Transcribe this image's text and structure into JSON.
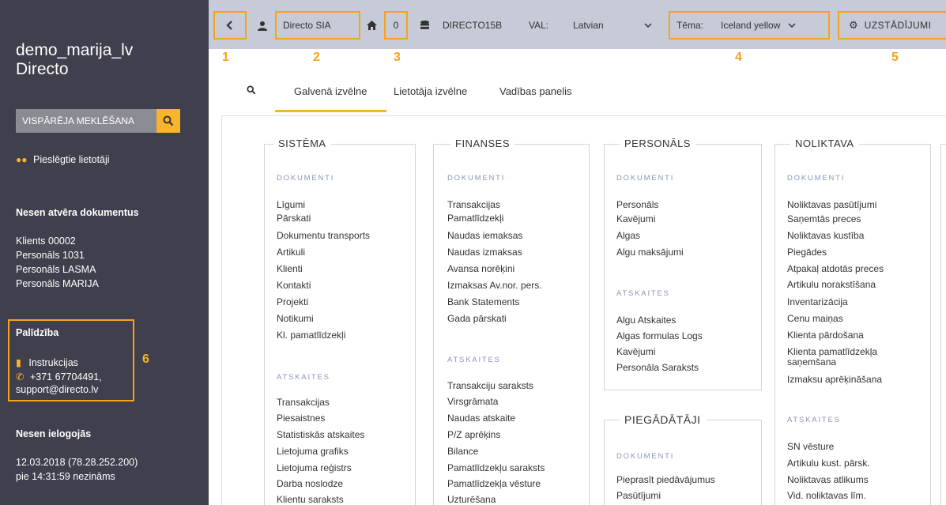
{
  "sidebar": {
    "user": "demo_marija_lv",
    "company": "Directo",
    "search_placeholder": "VISPĀRĒJA MEKLĒŠANA",
    "connected_users": "Pieslēgtie lietotāji",
    "recent_docs_title": "Nesen atvēra dokumentus",
    "recent_docs": [
      "Klients 00002",
      "Personāls 1031",
      "Personāls LASMA",
      "Personāls MARIJA"
    ],
    "help_title": "Palīdzība",
    "help_instructions": "Instrukcijas",
    "help_phone": "+371 67704491,",
    "help_email": "support@directo.lv",
    "help_number": "6",
    "recent_logins_title": "Nesen ielogojās",
    "recent_login_line1": "12.03.2018 (78.28.252.200)",
    "recent_login_line2": "pie 14:31:59 nezināms"
  },
  "topbar": {
    "company": "Directo SIA",
    "count": "0",
    "database": "DIRECTO15B",
    "val_label": "VAL:",
    "language": "Latvian",
    "theme_label": "Tēma:",
    "theme_value": "Iceland yellow",
    "settings_label": "UZSTĀDĪJUMI",
    "callouts": [
      "1",
      "2",
      "3",
      "4",
      "5"
    ]
  },
  "tabs": [
    "Galvenā izvēlne",
    "Lietotāja izvēlne",
    "Vadības panelis"
  ],
  "columns": {
    "sistema": {
      "title": "SISTĒMA",
      "doc_label": "DOKUMENTI",
      "docs": [
        "Līgumi",
        "Pārskati",
        "Dokumentu transports",
        "Artikuli",
        "Klienti",
        "Kontakti",
        "Projekti",
        "Notikumi",
        "Kl. pamatlīdzekļi"
      ],
      "rep_label": "ATSKAITES",
      "reports": [
        "Transakcijas",
        "Piesaistnes",
        "Statistiskās atskaites",
        "Lietojuma grafiks",
        "Lietojuma reģistrs",
        "Darba noslodze",
        "Klientu saraksts"
      ]
    },
    "finanses": {
      "title": "FINANSES",
      "doc_label": "DOKUMENTI",
      "docs": [
        "Transakcijas",
        "Pamatlīdzekļi",
        "Naudas iemaksas",
        "Naudas izmaksas",
        "Avansa norēķini",
        "Izmaksas Av.nor. pers.",
        "Bank Statements",
        "Gada pārskati"
      ],
      "rep_label": "ATSKAITES",
      "reports": [
        "Transakciju saraksts",
        "Virsgrāmata",
        "Naudas atskaite",
        "P/Z aprēķins",
        "Bilance",
        "Pamatlīdzekļu saraksts",
        "Pamatlīdzekļa vēsture",
        "Uzturēšana"
      ]
    },
    "personals": {
      "title": "PERSONĀLS",
      "doc_label": "DOKUMENTI",
      "docs": [
        "Personāls",
        "Kavējumi",
        "Algas",
        "Algu maksājumi"
      ],
      "rep_label": "ATSKAITES",
      "reports": [
        "Algu Atskaites",
        "Algas formulas Logs",
        "Kavējumi",
        "Personāla Saraksts"
      ]
    },
    "piegadataji": {
      "title": "PIEGĀDĀTĀJI",
      "doc_label": "DOKUMENTI",
      "docs": [
        "Pieprasīt piedāvājumus",
        "Pasūtījumi"
      ]
    },
    "noliktava": {
      "title": "NOLIKTAVA",
      "doc_label": "DOKUMENTI",
      "docs": [
        "Noliktavas pasūtījumi",
        "Saņemtās preces",
        "Noliktavas kustība",
        "Piegādes",
        "Atpakaļ atdotās preces",
        "Artikulu norakstīšana",
        "Inventarizācija",
        "Cenu maiņas",
        "Klienta pārdošana",
        "Klienta pamatlīdzekļa",
        "saņemšana",
        "Izmaksu aprēķināšana"
      ],
      "rep_label": "ATSKAITES",
      "reports": [
        "SN vēsture",
        "Artikulu kust. pārsk.",
        "Noliktavas atlikums",
        "Vid. noliktavas līm."
      ]
    }
  }
}
